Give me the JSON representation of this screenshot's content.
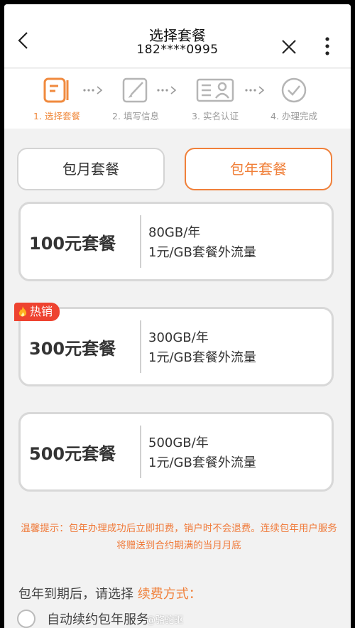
{
  "header": {
    "title": "选择套餐",
    "phone": "182****0995",
    "icons": [
      "back-icon",
      "close-icon",
      "more-vertical-icon"
    ]
  },
  "steps": [
    {
      "label": "1. 选择套餐",
      "icon": "list-doc-icon",
      "active": true
    },
    {
      "label": "2. 填写信息",
      "icon": "edit-icon",
      "active": false
    },
    {
      "label": "3. 实名认证",
      "icon": "id-card-icon",
      "active": false
    },
    {
      "label": "4. 办理完成",
      "icon": "check-circle-icon",
      "active": false
    }
  ],
  "tabs": {
    "monthly": "包月套餐",
    "yearly": "包年套餐",
    "selected": "yearly"
  },
  "plans": [
    {
      "name": "100元套餐",
      "data": "80GB/年",
      "overage": "1元/GB套餐外流量",
      "badge": ""
    },
    {
      "name": "300元套餐",
      "data": "300GB/年",
      "overage": "1元/GB套餐外流量",
      "badge": "热销"
    },
    {
      "name": "500元套餐",
      "data": "500GB/年",
      "overage": "1元/GB套餐外流量",
      "badge": ""
    }
  ],
  "notice": "温馨提示：包年办理成功后立即扣费，销户时不会退费。连续包年用户服务将赠送到合约期满的当月月底",
  "renewal": {
    "question": "包年到期后，请选择",
    "accent": "续费方式：",
    "auto_option": "自动续约包年服务"
  },
  "watermark": "@骆驼驱",
  "colors": {
    "accent": "#f0803a",
    "hot": "#ee4330",
    "notice": "#f07a3a"
  }
}
